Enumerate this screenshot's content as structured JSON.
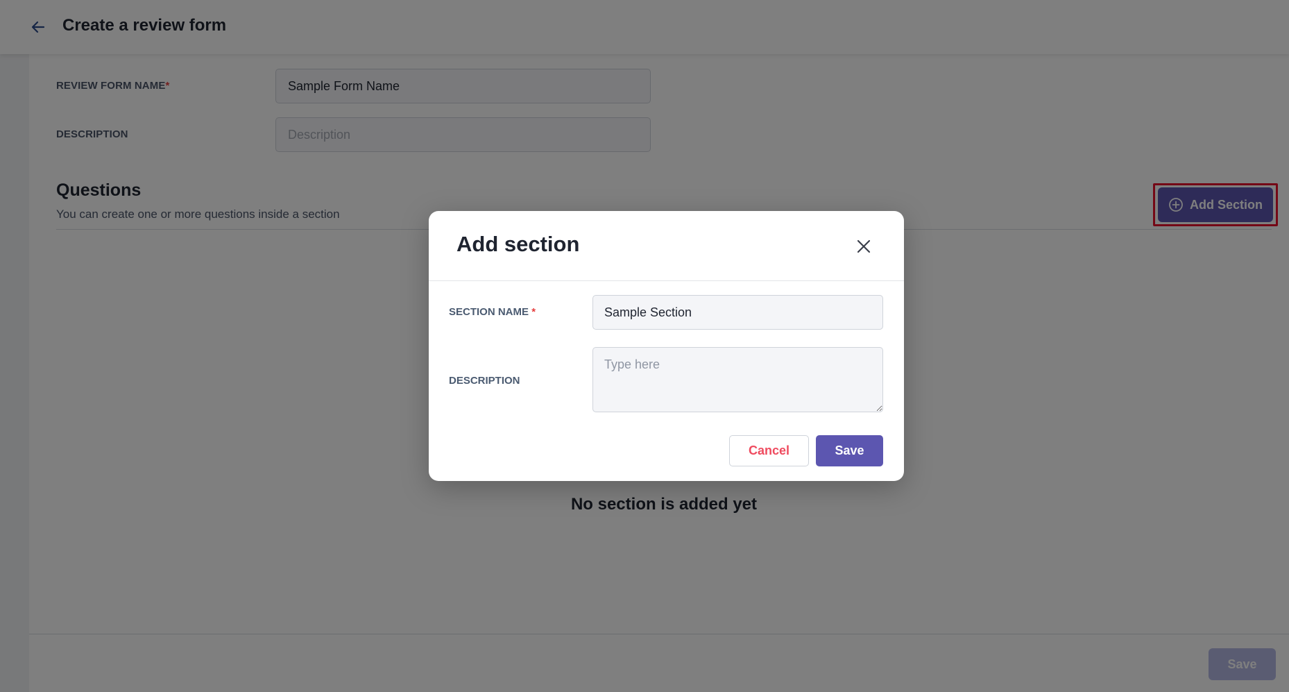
{
  "header": {
    "title": "Create a review form",
    "back_icon": "arrow-left-icon"
  },
  "form": {
    "name_label": "REVIEW FORM NAME",
    "required_mark": "*",
    "name_value": "Sample Form Name",
    "description_label": "DESCRIPTION",
    "description_placeholder": "Description"
  },
  "questions": {
    "title": "Questions",
    "subtitle": "You can create one or more questions inside a section",
    "add_section_label": "Add Section",
    "add_icon": "plus-circle-icon",
    "empty_text": "No section is added yet"
  },
  "footer": {
    "save_label": "Save"
  },
  "modal": {
    "title": "Add section",
    "close_icon": "close-icon",
    "section_name_label": "SECTION NAME",
    "required_mark": "*",
    "section_name_value": "Sample Section",
    "description_label": "DESCRIPTION",
    "description_placeholder": "Type here",
    "cancel_label": "Cancel",
    "save_label": "Save"
  },
  "colors": {
    "accent": "#5c56b0",
    "cancel_text": "#ef4b5f",
    "highlight_outline": "#e8112d",
    "required": "#e53e3e"
  }
}
